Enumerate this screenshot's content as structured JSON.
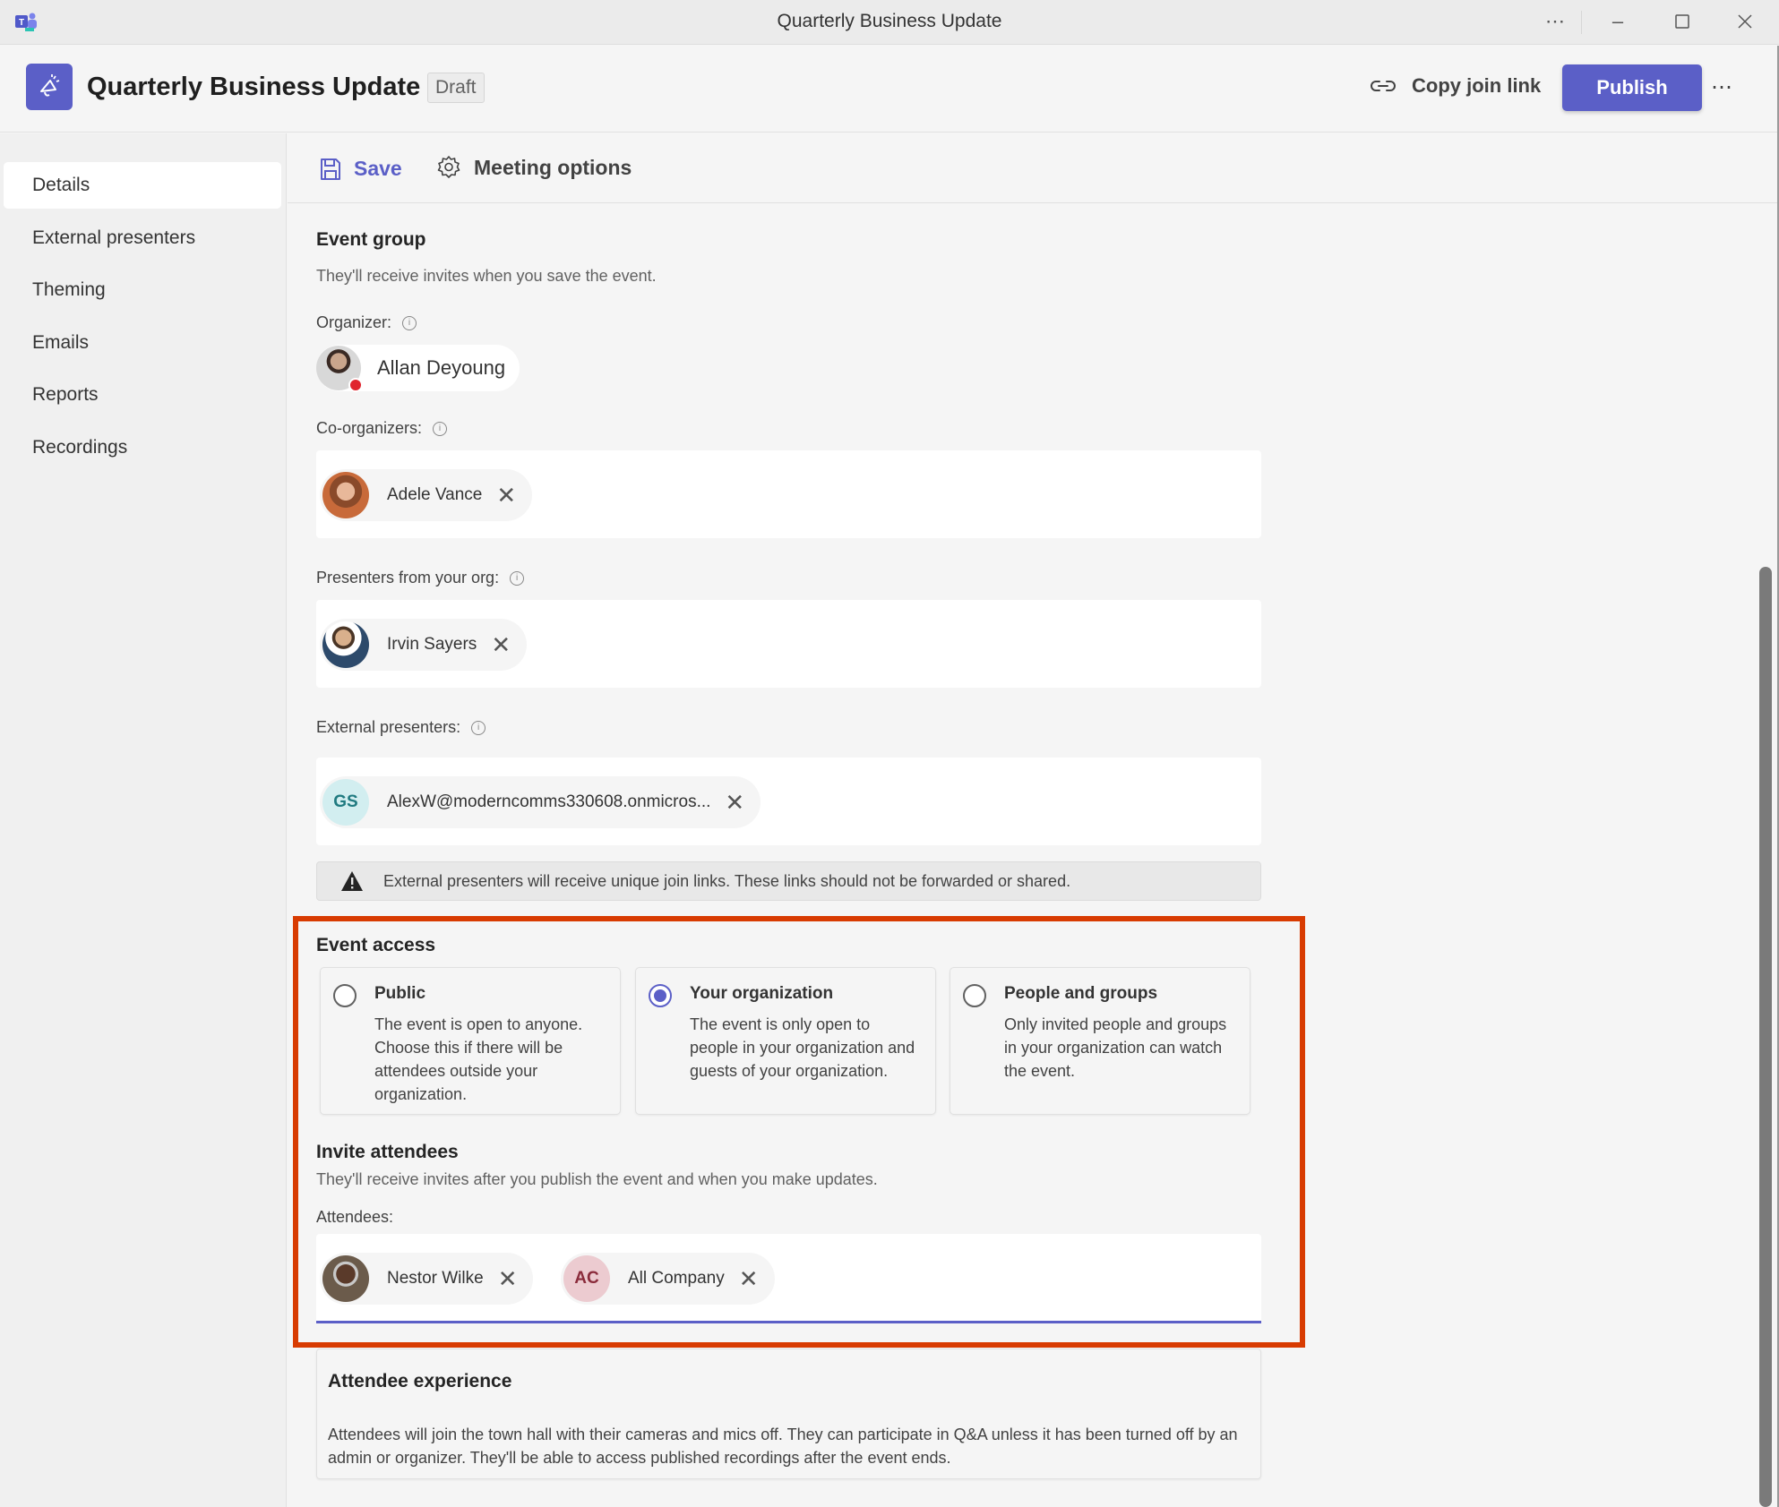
{
  "window": {
    "title": "Quarterly Business Update",
    "app_icon": "teams-icon",
    "controls": {
      "more": "⋯",
      "minimize": "–",
      "maximize": "☐",
      "close": "✕"
    }
  },
  "header": {
    "event_icon": "megaphone-icon",
    "title": "Quarterly Business Update",
    "status_badge": "Draft",
    "copy_link_label": "Copy join link",
    "publish_label": "Publish",
    "more_label": "⋯"
  },
  "sidebar": {
    "items": [
      {
        "label": "Details",
        "active": true
      },
      {
        "label": "External presenters",
        "active": false
      },
      {
        "label": "Theming",
        "active": false
      },
      {
        "label": "Emails",
        "active": false
      },
      {
        "label": "Reports",
        "active": false
      },
      {
        "label": "Recordings",
        "active": false
      }
    ]
  },
  "toolbar": {
    "save_label": "Save",
    "meeting_options_label": "Meeting options"
  },
  "event_group": {
    "heading": "Event group",
    "subtitle": "They'll receive invites when you save the event.",
    "organizer_label": "Organizer:",
    "organizer": {
      "name": "Allan Deyoung",
      "presence": "busy"
    },
    "coorganizers_label": "Co-organizers:",
    "coorganizers": [
      {
        "name": "Adele Vance"
      }
    ],
    "presenters_label": "Presenters from your org:",
    "presenters": [
      {
        "name": "Irvin Sayers"
      }
    ],
    "external_label": "External presenters:",
    "external_presenters": [
      {
        "initials": "GS",
        "name": "AlexW@moderncomms330608.onmicros..."
      }
    ],
    "warning": "External presenters will receive unique join links. These links should not be forwarded or shared."
  },
  "event_access": {
    "heading": "Event access",
    "options": [
      {
        "title": "Public",
        "description": "The event is open to anyone. Choose this if there will be attendees outside your organization.",
        "selected": false
      },
      {
        "title": "Your organization",
        "description": "The event is only open to people in your organization and guests of your organization.",
        "selected": true
      },
      {
        "title": "People and groups",
        "description": "Only invited people and groups in your organization can watch the event.",
        "selected": false
      }
    ]
  },
  "invite": {
    "heading": "Invite attendees",
    "subtitle": "They'll receive invites after you publish the event and when you make updates.",
    "attendees_label": "Attendees:",
    "attendees": [
      {
        "name": "Nestor Wilke",
        "initials": ""
      },
      {
        "name": "All Company",
        "initials": "AC"
      }
    ]
  },
  "attendee_experience": {
    "heading": "Attendee experience",
    "body": "Attendees will join the town hall with their cameras and mics off. They can participate in Q&A unless it has been turned off by an admin or organizer. They'll be able to access published recordings after the event ends."
  },
  "colors": {
    "brand": "#5b5fc7",
    "highlight_box": "#d83b01",
    "presence_busy": "#e0252e"
  }
}
